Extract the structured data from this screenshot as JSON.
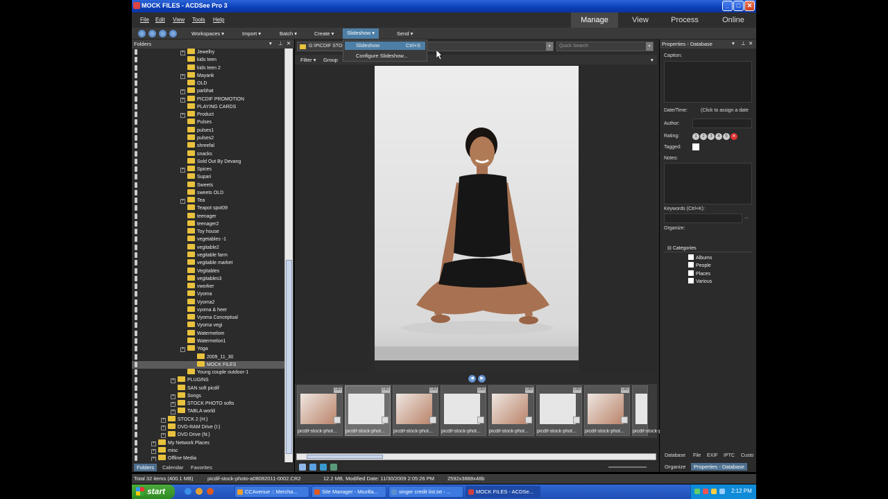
{
  "window": {
    "title": "MOCK FILES - ACDSee Pro 3"
  },
  "menubar": {
    "items": [
      "File",
      "Edit",
      "View",
      "Tools",
      "Help"
    ],
    "modes": [
      "Manage",
      "View",
      "Process",
      "Online"
    ],
    "active_mode": "Manage"
  },
  "toolbar": {
    "items": [
      "Workspaces",
      "Import",
      "Batch",
      "Create",
      "Slideshow",
      "Send"
    ],
    "active_item": "Slideshow"
  },
  "slideshow_menu": {
    "items": [
      {
        "label": "Slideshow",
        "shortcut": "Ctrl+S"
      },
      {
        "label": "Configure Slideshow...",
        "shortcut": ""
      }
    ]
  },
  "folders_panel": {
    "title": "Folders",
    "tree": [
      {
        "label": "Jewellry",
        "indent": 3,
        "expander": true
      },
      {
        "label": "kids teen",
        "indent": 3,
        "expander": false
      },
      {
        "label": "kids teen 2",
        "indent": 3,
        "expander": false
      },
      {
        "label": "Mayank",
        "indent": 3,
        "expander": true
      },
      {
        "label": "OLD",
        "indent": 3,
        "expander": false
      },
      {
        "label": "parbhat",
        "indent": 3,
        "expander": true
      },
      {
        "label": "PICDIF PROMOTION",
        "indent": 3,
        "expander": true
      },
      {
        "label": "PLAYING CARDS",
        "indent": 3,
        "expander": false
      },
      {
        "label": "Product",
        "indent": 3,
        "expander": true
      },
      {
        "label": "Pulses",
        "indent": 3,
        "expander": false
      },
      {
        "label": "pulses1",
        "indent": 3,
        "expander": false
      },
      {
        "label": "pulses2",
        "indent": 3,
        "expander": false
      },
      {
        "label": "shreefal",
        "indent": 3,
        "expander": false
      },
      {
        "label": "snacks",
        "indent": 3,
        "expander": false
      },
      {
        "label": "Sold Out By Devang",
        "indent": 3,
        "expander": false
      },
      {
        "label": "Spices",
        "indent": 3,
        "expander": true
      },
      {
        "label": "Supari",
        "indent": 3,
        "expander": false
      },
      {
        "label": "Sweets",
        "indent": 3,
        "expander": false
      },
      {
        "label": "sweets OLD",
        "indent": 3,
        "expander": false
      },
      {
        "label": "Tea",
        "indent": 3,
        "expander": true
      },
      {
        "label": "Teapot spot09",
        "indent": 3,
        "expander": false
      },
      {
        "label": "teenager",
        "indent": 3,
        "expander": false
      },
      {
        "label": "teenager2",
        "indent": 3,
        "expander": false
      },
      {
        "label": "Toy house",
        "indent": 3,
        "expander": false
      },
      {
        "label": "vegetables -1",
        "indent": 3,
        "expander": false
      },
      {
        "label": "vegitable2",
        "indent": 3,
        "expander": false
      },
      {
        "label": "vegitable farm",
        "indent": 3,
        "expander": false
      },
      {
        "label": "vegitable market",
        "indent": 3,
        "expander": false
      },
      {
        "label": "Vegitables",
        "indent": 3,
        "expander": false
      },
      {
        "label": "vegitables3",
        "indent": 3,
        "expander": false
      },
      {
        "label": "vworker",
        "indent": 3,
        "expander": false
      },
      {
        "label": "Vyoma",
        "indent": 3,
        "expander": false
      },
      {
        "label": "Vyoma2",
        "indent": 3,
        "expander": false
      },
      {
        "label": "vyoma & heer",
        "indent": 3,
        "expander": false
      },
      {
        "label": "Vyoma Conceptual",
        "indent": 3,
        "expander": false
      },
      {
        "label": "Vyoma vegi",
        "indent": 3,
        "expander": false
      },
      {
        "label": "Watermelom",
        "indent": 3,
        "expander": false
      },
      {
        "label": "Watermelon1",
        "indent": 3,
        "expander": false
      },
      {
        "label": "Yoga",
        "indent": 3,
        "expander": true
      },
      {
        "label": "2009_11_30",
        "indent": 4,
        "expander": false
      },
      {
        "label": "MOCK FILES",
        "indent": 4,
        "expander": false,
        "selected": true
      },
      {
        "label": "Young couple outdoor-1",
        "indent": 3,
        "expander": false
      },
      {
        "label": "PLUGINS",
        "indent": 2,
        "expander": true
      },
      {
        "label": "SAN soft picdif",
        "indent": 2,
        "expander": false
      },
      {
        "label": "Songs",
        "indent": 2,
        "expander": true
      },
      {
        "label": "STOCK PHOTO softs",
        "indent": 2,
        "expander": true
      },
      {
        "label": "TABLA world",
        "indent": 2,
        "expander": true
      },
      {
        "label": "STOCK 2 (H:)",
        "indent": 1,
        "expander": true
      },
      {
        "label": "DVD-RAM Drive (I:)",
        "indent": 1,
        "expander": true
      },
      {
        "label": "DVD Drive (N:)",
        "indent": 1,
        "expander": true
      },
      {
        "label": "My Network Places",
        "indent": 0,
        "expander": true
      },
      {
        "label": "misc",
        "indent": 0,
        "expander": true
      },
      {
        "label": "Offline Media",
        "indent": 0,
        "expander": true
      }
    ],
    "tabs": [
      "Folders",
      "Calendar",
      "Favorites"
    ],
    "active_tab": "Folders"
  },
  "center": {
    "path": "G:\\PICDIF STOC",
    "quick_search_placeholder": "Quick Search",
    "filter_label": "Filter",
    "group_label": "Group",
    "thumbnails": [
      {
        "caption": "picdif-stock-phot..."
      },
      {
        "caption": "picdif-stock-phot...",
        "selected": true
      },
      {
        "caption": "picdif-stock-phot..."
      },
      {
        "caption": "picdif-stock-phot..."
      },
      {
        "caption": "picdif-stock-phot..."
      },
      {
        "caption": "picdif-stock-phot..."
      },
      {
        "caption": "picdif-stock-phot..."
      },
      {
        "caption": "picdif-stock-phot..."
      }
    ]
  },
  "properties": {
    "title": "Properties - Database",
    "caption_label": "Caption:",
    "datetime_label": "Date/Time:",
    "datetime_value": "(Click to assign a date",
    "author_label": "Author:",
    "rating_label": "Rating:",
    "rating_values": [
      "1",
      "2",
      "3",
      "4",
      "5"
    ],
    "tagged_label": "Tagged:",
    "notes_label": "Notes:",
    "keywords_label": "Keywords (Ctrl+K):",
    "keywords_button": "...",
    "organize_label": "Organize:",
    "categories_label": "Categories",
    "categories": [
      "Albums",
      "People",
      "Places",
      "Various"
    ],
    "tabs": [
      "Database",
      "File",
      "EXIF",
      "IPTC",
      "Custo"
    ],
    "footer_tabs": [
      "Organize",
      "Properties - Database"
    ]
  },
  "status": {
    "total": "Total 32 items  (400.1 MB)",
    "filename": "picdif-stock-photo-a08082011-0002.CR2",
    "details": "12.2 MB, Modified Date: 11/30/2009 2:05:26 PM",
    "dimensions": "2592x3888x48b"
  },
  "taskbar": {
    "start_label": "start",
    "tasks": [
      {
        "label": "CCAvenue :: Mercha...",
        "color": "#f0a030"
      },
      {
        "label": "Site Manager - Mozilla...",
        "color": "#e05a1e"
      },
      {
        "label": "singer credit list.txt - ...",
        "color": "#5a8fd0"
      },
      {
        "label": "MOCK FILES - ACDSe...",
        "color": "#d04040",
        "active": true
      }
    ],
    "clock": "2:12 PM"
  }
}
